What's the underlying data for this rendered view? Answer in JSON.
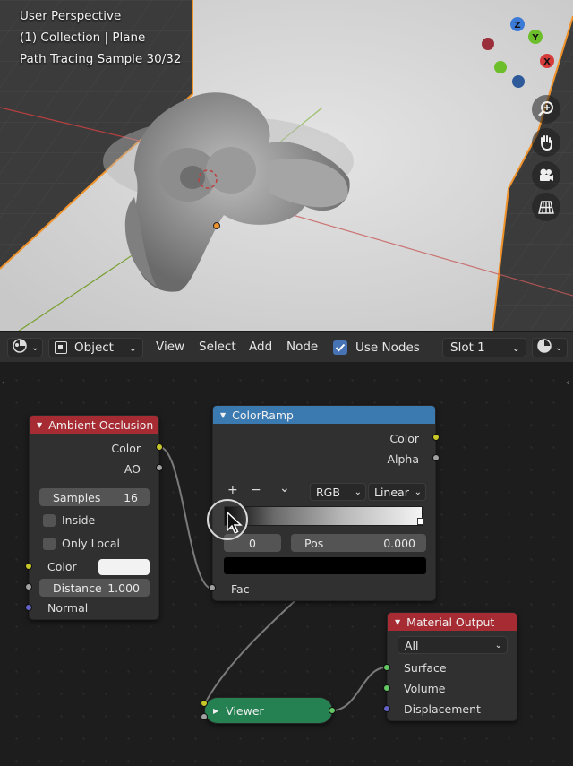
{
  "viewport": {
    "overlay": [
      "User Perspective",
      "(1) Collection | Plane",
      "Path Tracing Sample 30/32"
    ],
    "gizmo": {
      "z": "Z",
      "y": "Y",
      "x": "X"
    },
    "nav_icons": [
      "zoom-icon",
      "hand-icon",
      "camera-icon",
      "grid-icon"
    ]
  },
  "header": {
    "editor_icon": "node-editor-icon",
    "mode": "Object",
    "menus": [
      "View",
      "Select",
      "Add",
      "Node"
    ],
    "use_nodes_label": "Use Nodes",
    "use_nodes_checked": true,
    "slot": "Slot 1"
  },
  "nodes": {
    "ambient_occlusion": {
      "title": "Ambient Occlusion",
      "outputs": [
        "Color",
        "AO"
      ],
      "samples_label": "Samples",
      "samples_value": "16",
      "inside_label": "Inside",
      "only_local_label": "Only Local",
      "color_label": "Color",
      "distance_label": "Distance",
      "distance_value": "1.000",
      "normal_label": "Normal",
      "color": "#f2f2f2",
      "header_color": "#a62b32"
    },
    "color_ramp": {
      "title": "ColorRamp",
      "outputs": [
        "Color",
        "Alpha"
      ],
      "add_symbol": "+",
      "remove_symbol": "−",
      "menu_symbol": "⌄",
      "color_mode": "RGB",
      "interpolation": "Linear",
      "index": "0",
      "pos_label": "Pos",
      "pos_value": "0.000",
      "fac_label": "Fac",
      "header_color": "#3b7ab0"
    },
    "viewer": {
      "title": "Viewer",
      "color": "#258152"
    },
    "material_output": {
      "title": "Material Output",
      "target": "All",
      "inputs": [
        "Surface",
        "Volume",
        "Displacement"
      ],
      "header_color": "#a62b32"
    }
  }
}
